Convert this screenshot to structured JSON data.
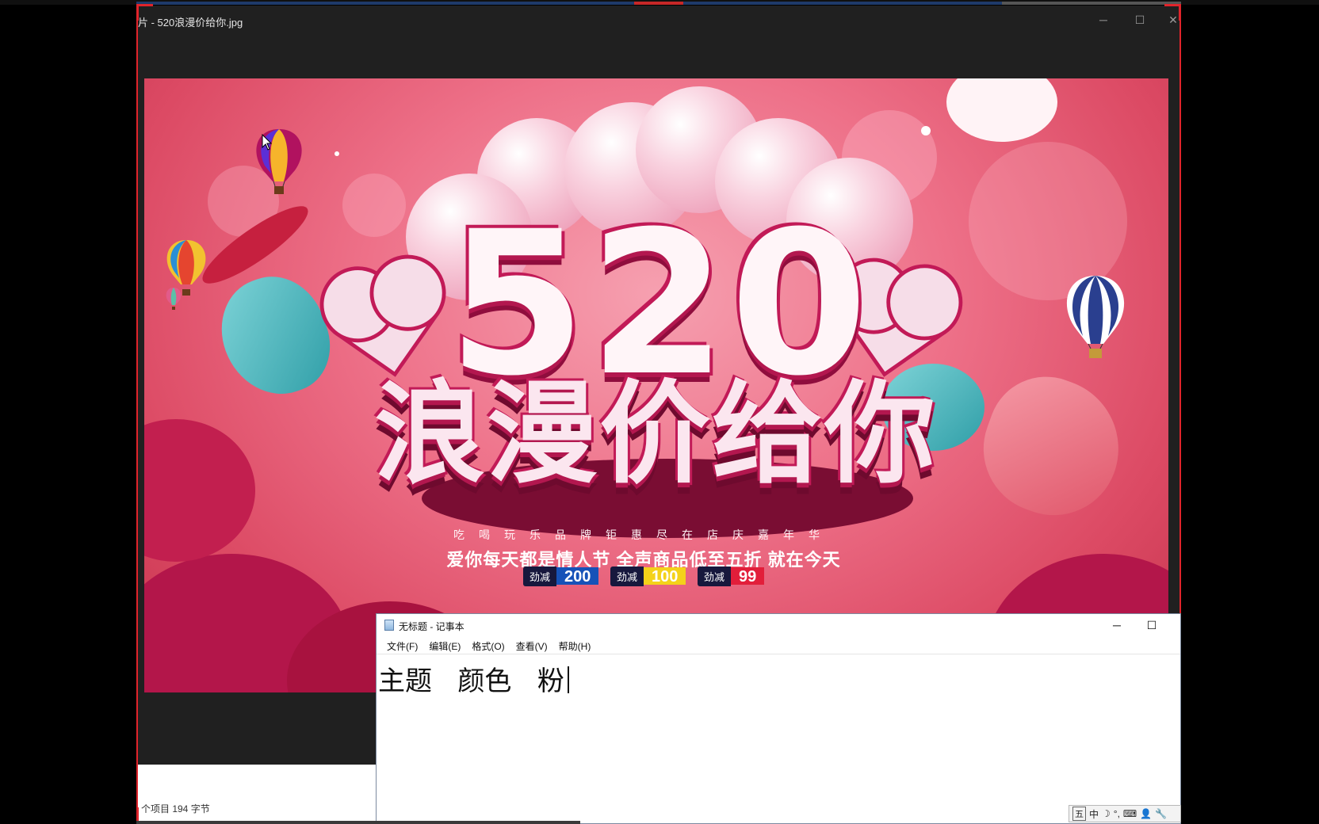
{
  "viewer": {
    "title": "片 - 520浪漫价给你.jpg",
    "minimize": "─",
    "maximize": "☐",
    "close": "✕",
    "status": "个项目  194 字节"
  },
  "banner": {
    "number": "520",
    "headline": "浪漫价给你",
    "tagline_small": "吃喝玩乐品牌钜惠尽在店庆嘉年华",
    "tagline_big": "爱你每天都是情人节 全声商品低至五折 就在今天",
    "coupons": [
      {
        "tag": "劲减",
        "value": "200",
        "color": "#1652b8"
      },
      {
        "tag": "劲减",
        "value": "100",
        "color": "#f4d21a"
      },
      {
        "tag": "劲减",
        "value": "99",
        "color": "#e21e3a"
      }
    ]
  },
  "notepad": {
    "title": "无标题 - 记事本",
    "minimize": "─",
    "maximize": "☐",
    "menu": [
      "文件(F)",
      "编辑(E)",
      "格式(O)",
      "查看(V)",
      "帮助(H)"
    ],
    "content": "主题   颜色   粉"
  },
  "ime": {
    "items": [
      "五",
      "中",
      "☽",
      "°,",
      "⌨",
      "👤",
      "🔧"
    ]
  }
}
